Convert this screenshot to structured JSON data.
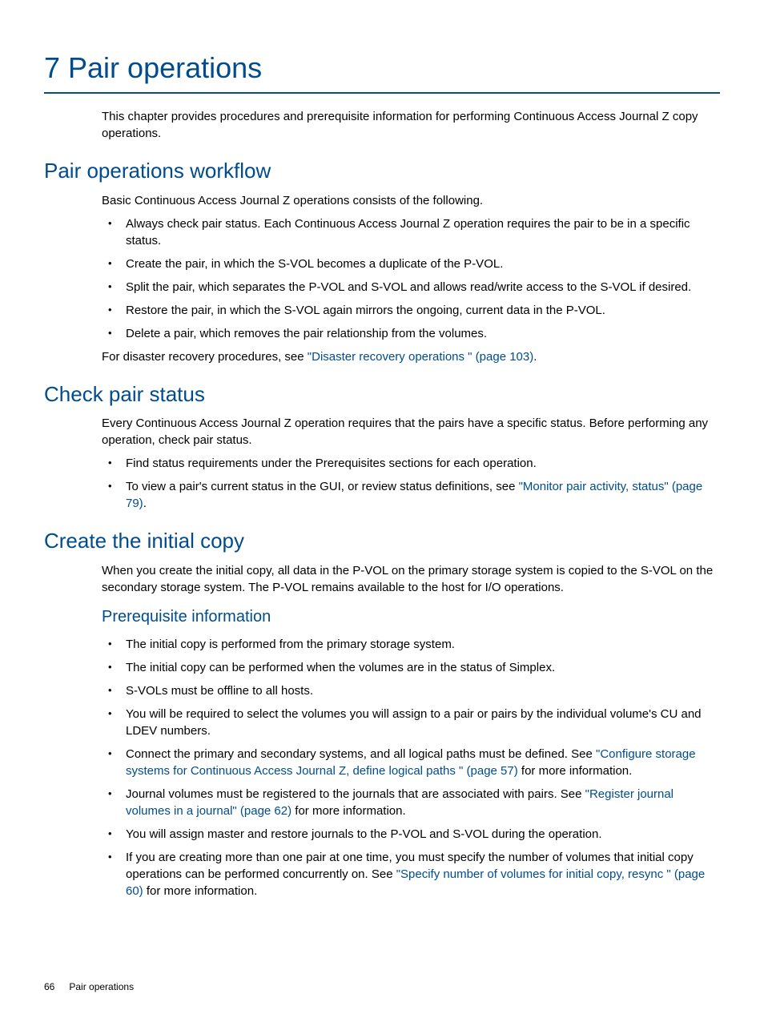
{
  "chapter": {
    "title": "7 Pair operations"
  },
  "intro": "This chapter provides procedures and prerequisite information for performing Continuous Access Journal Z copy operations.",
  "section1": {
    "title": "Pair operations workflow",
    "intro": "Basic Continuous Access Journal Z operations consists of the following.",
    "bullets": [
      "Always check pair status. Each Continuous Access Journal Z operation requires the pair to be in a specific status.",
      "Create the pair, in which the S-VOL becomes a duplicate of the P-VOL.",
      "Split the pair, which separates the P-VOL and S-VOL and allows read/write access to the S-VOL if desired.",
      "Restore the pair, in which the S-VOL again mirrors the ongoing, current data in the P-VOL.",
      "Delete a pair, which removes the pair relationship from the volumes."
    ],
    "outro_prefix": "For disaster recovery procedures, see ",
    "outro_link": "\"Disaster recovery operations \" (page 103)",
    "outro_suffix": "."
  },
  "section2": {
    "title": "Check pair status",
    "intro": "Every Continuous Access Journal Z operation requires that the pairs have a specific status. Before performing any operation, check pair status.",
    "bullet1": "Find status requirements under the Prerequisites sections for each operation.",
    "bullet2_prefix": "To view a pair's current status in the GUI, or review status definitions, see ",
    "bullet2_link": "\"Monitor pair activity, status\" (page 79)",
    "bullet2_suffix": "."
  },
  "section3": {
    "title": "Create the initial copy",
    "intro": "When you create the initial copy, all data in the P-VOL on the primary storage system is copied to the S-VOL on the secondary storage system. The P-VOL remains available to the host for I/O operations.",
    "subsection_title": "Prerequisite information",
    "b1": "The initial copy is performed from the primary storage system.",
    "b2": "The initial copy can be performed when the volumes are in the status of Simplex.",
    "b3": "S-VOLs must be offline to all hosts.",
    "b4": "You will be required to select the volumes you will assign to a pair or pairs by the individual volume's CU and LDEV numbers.",
    "b5_prefix": "Connect the primary and secondary systems, and all logical paths must be defined. See ",
    "b5_link": "\"Configure storage systems for Continuous Access Journal Z, define logical paths \" (page 57)",
    "b5_suffix": " for more information.",
    "b6_prefix": "Journal volumes must be registered to the journals that are associated with pairs. See ",
    "b6_link": "\"Register journal volumes in a journal\" (page 62)",
    "b6_suffix": " for more information.",
    "b7": "You will assign master and restore journals to the P-VOL and S-VOL during the operation.",
    "b8_prefix": "If you are creating more than one pair at one time, you must specify the number of volumes that initial copy operations can be performed concurrently on. See ",
    "b8_link": "\"Specify number of volumes for initial copy, resync \" (page 60)",
    "b8_suffix": " for more information."
  },
  "footer": {
    "page": "66",
    "label": "Pair operations"
  }
}
